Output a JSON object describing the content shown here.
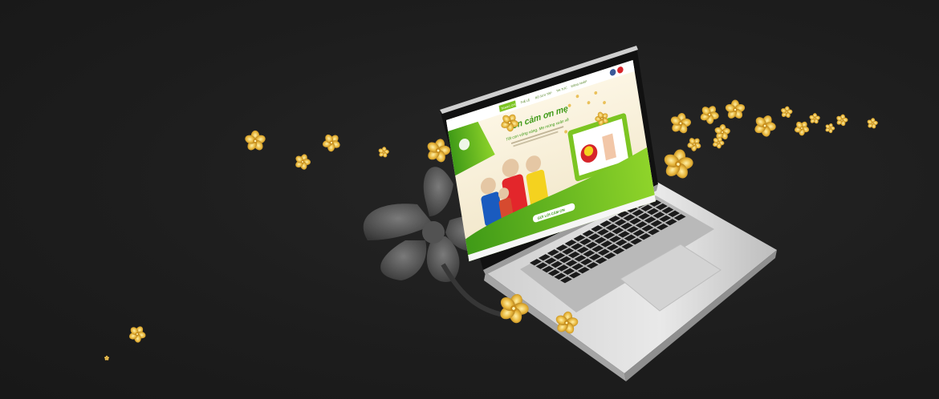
{
  "screen": {
    "nav_items": [
      "TRANG CHỦ",
      "THỂ LỆ",
      "BỘ SƯU TẬP",
      "TIN TỨC",
      "ĐĂNG NHẬP"
    ],
    "headline": "Con cảm ơn mẹ",
    "subheadline": "Tết con vững vàng, Mẹ mừng xuân về",
    "cta_label": "GỬI LỜI CẢM ƠN",
    "brand_logo": "unilever-logo"
  },
  "icons": [
    "facebook-icon",
    "youtube-icon"
  ],
  "colors": {
    "background": "#1e1e1e",
    "site_green": "#7cc522",
    "gold_blossom": "#e7b53a",
    "laptop_silver": "#d9d9d9"
  }
}
